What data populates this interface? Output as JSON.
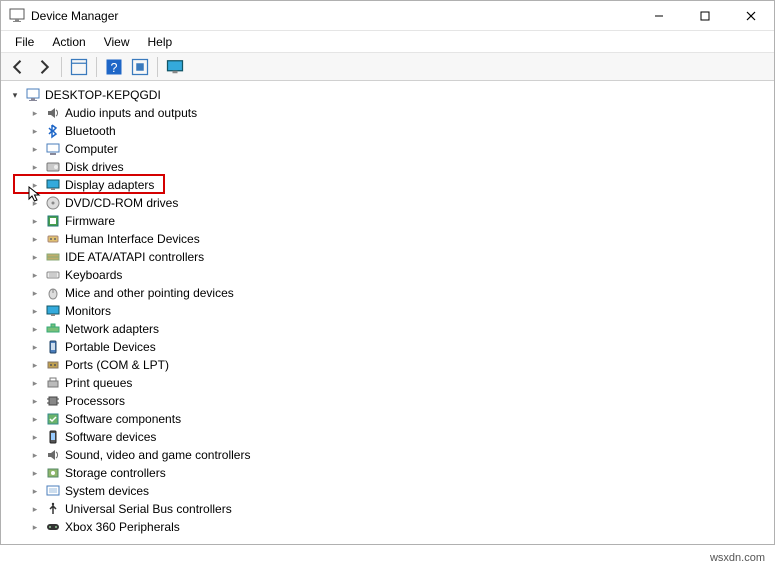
{
  "window": {
    "title": "Device Manager"
  },
  "menu": {
    "items": [
      "File",
      "Action",
      "View",
      "Help"
    ]
  },
  "toolbar": {
    "back": "Back",
    "forward": "Forward",
    "show_hidden": "Show hidden",
    "help": "Help",
    "scan": "Scan for hardware changes",
    "monitor": "Display"
  },
  "controls": {
    "min": "Minimize",
    "max": "Maximize",
    "close": "Close"
  },
  "tree": {
    "root": "DESKTOP-KEPQGDI",
    "categories": [
      {
        "label": "Audio inputs and outputs",
        "highlight": false
      },
      {
        "label": "Bluetooth",
        "highlight": false
      },
      {
        "label": "Computer",
        "highlight": false
      },
      {
        "label": "Disk drives",
        "highlight": false
      },
      {
        "label": "Display adapters",
        "highlight": true
      },
      {
        "label": "DVD/CD-ROM drives",
        "highlight": false
      },
      {
        "label": "Firmware",
        "highlight": false
      },
      {
        "label": "Human Interface Devices",
        "highlight": false
      },
      {
        "label": "IDE ATA/ATAPI controllers",
        "highlight": false
      },
      {
        "label": "Keyboards",
        "highlight": false
      },
      {
        "label": "Mice and other pointing devices",
        "highlight": false
      },
      {
        "label": "Monitors",
        "highlight": false
      },
      {
        "label": "Network adapters",
        "highlight": false
      },
      {
        "label": "Portable Devices",
        "highlight": false
      },
      {
        "label": "Ports (COM & LPT)",
        "highlight": false
      },
      {
        "label": "Print queues",
        "highlight": false
      },
      {
        "label": "Processors",
        "highlight": false
      },
      {
        "label": "Software components",
        "highlight": false
      },
      {
        "label": "Software devices",
        "highlight": false
      },
      {
        "label": "Sound, video and game controllers",
        "highlight": false
      },
      {
        "label": "Storage controllers",
        "highlight": false
      },
      {
        "label": "System devices",
        "highlight": false
      },
      {
        "label": "Universal Serial Bus controllers",
        "highlight": false
      },
      {
        "label": "Xbox 360 Peripherals",
        "highlight": false
      }
    ]
  },
  "watermark": "wsxdn.com"
}
